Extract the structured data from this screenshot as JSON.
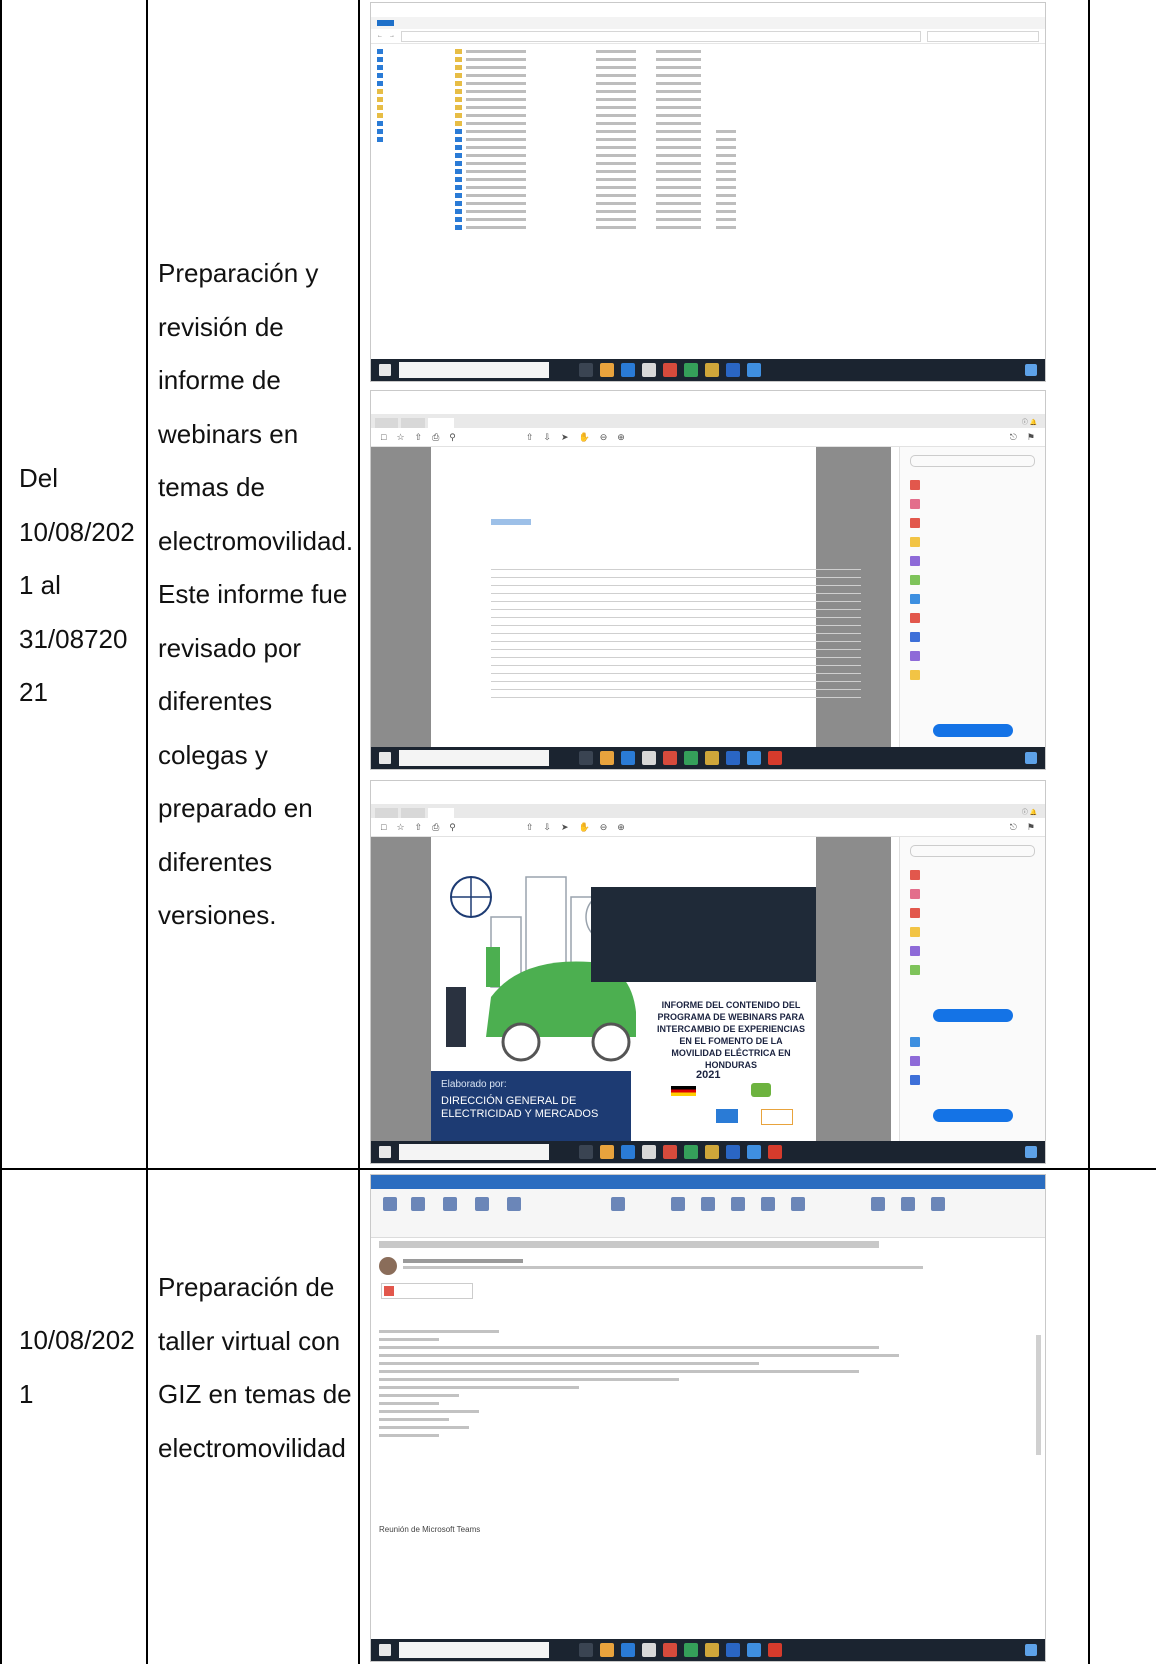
{
  "rows": [
    {
      "date_lines": [
        "Del",
        "10/08/202",
        "1 al",
        "31/08720",
        "21"
      ],
      "activity_lines": [
        "Preparación y",
        "revisión de",
        "informe de",
        "webinars en",
        "temas de",
        "electromovilidad.",
        "Este informe fue",
        "revisado por",
        "diferentes",
        "colegas y",
        "preparado en",
        "diferentes",
        "versiones."
      ]
    },
    {
      "date_lines": [
        "10/08/202",
        "1"
      ],
      "activity_lines": [
        "Preparación de",
        "taller virtual con",
        "GIZ en temas de",
        "electromovilidad"
      ]
    }
  ],
  "screenshots": {
    "pdf_cover": {
      "cover_title": [
        "INFORME DEL CONTENIDO DEL",
        "PROGRAMA DE WEBINARS PARA",
        "INTERCAMBIO DE EXPERIENCIAS",
        "EN EL FOMENTO DE LA",
        "MOVILIDAD ELÉCTRICA EN",
        "HONDURAS"
      ],
      "year": "2021",
      "prepared_by": "Elaborado por:",
      "direction": [
        "DIRECCIÓN GENERAL DE",
        "ELECTRICIDAD Y MERCADOS"
      ]
    },
    "outlook": {
      "teams_heading": "Reunión de Microsoft Teams"
    }
  },
  "colors": {
    "taskbar": "#1b2430",
    "explorer_accent": "#1e70c9",
    "folder": "#e7bd45",
    "pdf_gray": "#8c8c8c",
    "cover_navy": "#1d3b73",
    "car_green": "#4caf50",
    "outlook_blue": "#2b6dc0"
  }
}
